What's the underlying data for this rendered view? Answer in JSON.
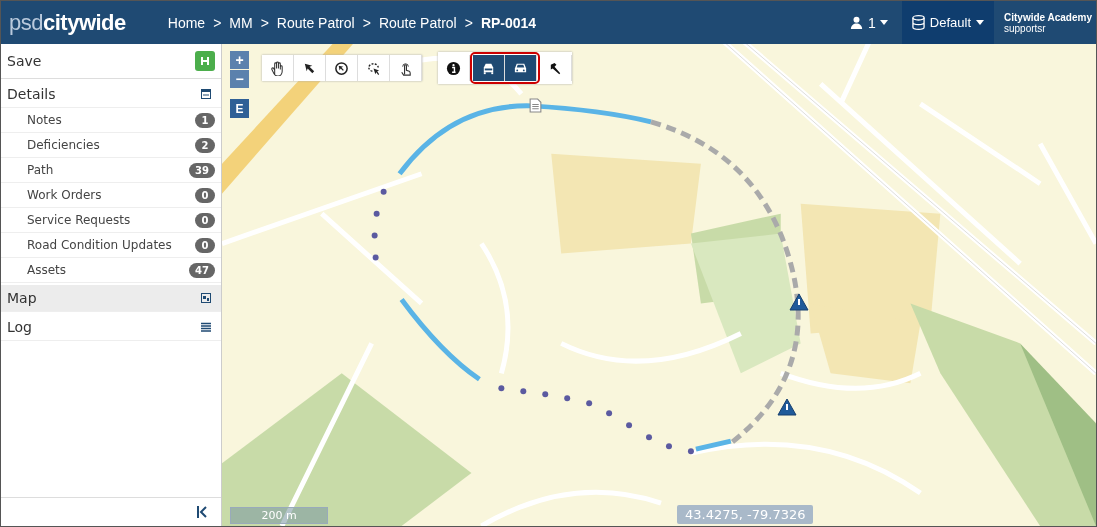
{
  "header": {
    "logo_parts": [
      "psd",
      "citywide"
    ],
    "breadcrumbs": [
      {
        "label": "Home",
        "current": false
      },
      {
        "label": "MM",
        "current": false
      },
      {
        "label": "Route Patrol",
        "current": false
      },
      {
        "label": "Route Patrol",
        "current": false
      },
      {
        "label": "RP-0014",
        "current": true
      }
    ],
    "separator": ">",
    "user_count": "1",
    "profile": "Default",
    "org": "Citywide Academy",
    "user": "supportsr"
  },
  "sidebar": {
    "save": "Save",
    "sections": [
      {
        "label": "Details",
        "selected": false,
        "kind": "details",
        "items": [
          {
            "label": "Notes",
            "count": "1"
          },
          {
            "label": "Deficiencies",
            "count": "2"
          },
          {
            "label": "Path",
            "count": "39"
          },
          {
            "label": "Work Orders",
            "count": "0"
          },
          {
            "label": "Service Requests",
            "count": "0"
          },
          {
            "label": "Road Condition Updates",
            "count": "0"
          },
          {
            "label": "Assets",
            "count": "47"
          }
        ]
      },
      {
        "label": "Map",
        "selected": true,
        "kind": "map"
      },
      {
        "label": "Log",
        "selected": false,
        "kind": "log"
      }
    ]
  },
  "map": {
    "zoom_in": "+",
    "zoom_out": "−",
    "edit_button": "E",
    "tool_groups": [
      [
        {
          "selected": false
        },
        {
          "selected": false
        },
        {
          "selected": false
        },
        {
          "selected": false
        },
        {
          "selected": false
        }
      ],
      [
        {
          "selected": false
        },
        {
          "selected": true
        },
        {
          "selected": true
        },
        {
          "selected": false
        }
      ]
    ],
    "scale": "200 m",
    "coordinates": "43.4275, -79.7326"
  }
}
